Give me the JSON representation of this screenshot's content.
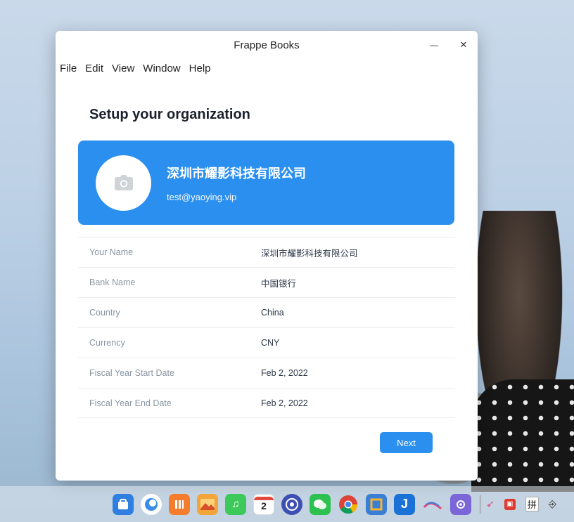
{
  "window": {
    "title": "Frappe Books",
    "minimize_glyph": "—",
    "close_glyph": "✕"
  },
  "menu": [
    "File",
    "Edit",
    "View",
    "Window",
    "Help"
  ],
  "page": {
    "title": "Setup your organization"
  },
  "org_card": {
    "name": "深圳市耀影科技有限公司",
    "email": "test@yaoying.vip",
    "icon": "camera-icon",
    "color": "#2b8ff0"
  },
  "fields": [
    {
      "label": "Your Name",
      "value": "深圳市耀影科技有限公司"
    },
    {
      "label": "Bank Name",
      "value": "中国银行"
    },
    {
      "label": "Country",
      "value": "China"
    },
    {
      "label": "Currency",
      "value": "CNY"
    },
    {
      "label": "Fiscal Year Start Date",
      "value": "Feb 2, 2022"
    },
    {
      "label": "Fiscal Year End Date",
      "value": "Feb 2, 2022"
    }
  ],
  "actions": {
    "next_label": "Next"
  },
  "dock": {
    "calendar_day": "2",
    "tray_input_method": "拼"
  }
}
